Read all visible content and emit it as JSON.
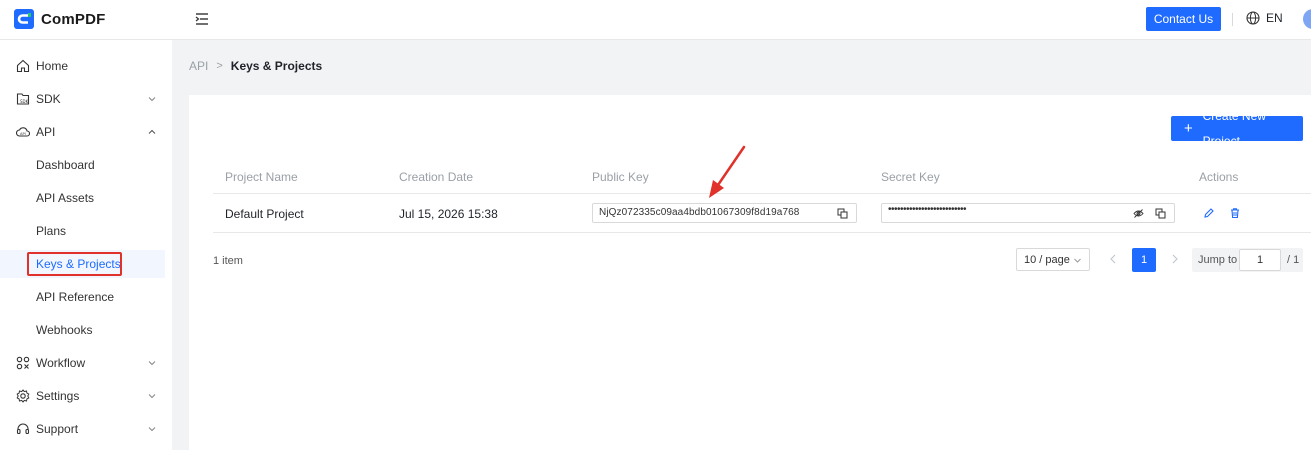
{
  "brand": {
    "name": "ComPDF",
    "color": "#1f6bff"
  },
  "header": {
    "menu_icon": "menu-fold-icon",
    "contact_label": "Contact Us",
    "language_icon": "globe-icon",
    "language": "EN"
  },
  "sidebar": {
    "items": [
      {
        "label": "Home",
        "icon": "home-icon"
      },
      {
        "label": "SDK",
        "icon": "sdk-icon",
        "expandable": true
      },
      {
        "label": "API",
        "icon": "cloud-api-icon",
        "expanded": true
      },
      {
        "label": "Workflow",
        "icon": "workflow-icon",
        "expandable": true
      },
      {
        "label": "Settings",
        "icon": "gear-icon",
        "expandable": true
      },
      {
        "label": "Support",
        "icon": "headset-icon",
        "expandable": true
      }
    ],
    "api_children": [
      {
        "label": "Dashboard"
      },
      {
        "label": "API Assets"
      },
      {
        "label": "Plans"
      },
      {
        "label": "Keys & Projects",
        "active": true
      },
      {
        "label": "API Reference"
      },
      {
        "label": "Webhooks"
      }
    ]
  },
  "breadcrumb": {
    "root": "API",
    "current": "Keys & Projects"
  },
  "main": {
    "create_label": "Create New Project",
    "table": {
      "columns": [
        "Project Name",
        "Creation Date",
        "Public Key",
        "Secret Key",
        "Actions"
      ],
      "rows": [
        {
          "project_name": "Default Project",
          "creation_date": "Jul 15, 2026 15:38",
          "public_key": "NjQz072335c09aa4bdb01067309f8d19a768",
          "secret_key_masked": "••••••••••••••••••••••••••"
        }
      ]
    },
    "pagination": {
      "total_text": "1 item",
      "page_size": "10 / page",
      "current_page": "1",
      "jump_label": "Jump to",
      "jump_value": "1",
      "total_pages": "/ 1"
    }
  },
  "colors": {
    "accent": "#1f6bff",
    "highlight": "#e0312b",
    "background": "#f2f3f5"
  }
}
